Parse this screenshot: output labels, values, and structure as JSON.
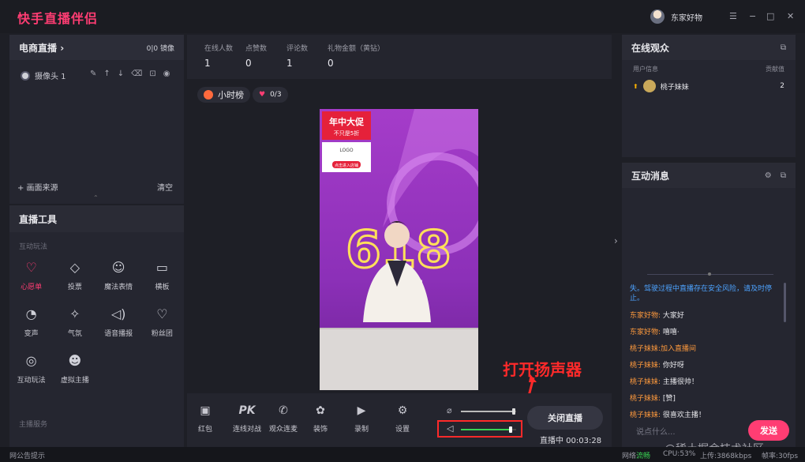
{
  "app": {
    "title": "快手直播伴侣",
    "user": "东家好物"
  },
  "window_controls": {
    "menu": "☰",
    "min": "−",
    "max": "□",
    "close": "✕"
  },
  "left_top": {
    "title": "电商直播",
    "title_suffix": "›",
    "camera_switch": "0|0 镜像",
    "camera_label": "摄像头 1",
    "add_source": "+ 画面来源",
    "clear": "清空"
  },
  "tools": {
    "title": "直播工具",
    "section_interact": "互动玩法",
    "section_anchor": "主播服务",
    "items": [
      {
        "label": "心愿单",
        "icon": "♡",
        "active": true
      },
      {
        "label": "投票",
        "icon": "◇"
      },
      {
        "label": "魔法表情",
        "icon": "☺"
      },
      {
        "label": "横板",
        "icon": "▭"
      },
      {
        "label": "变声",
        "icon": "◔"
      },
      {
        "label": "气氛",
        "icon": "✧"
      },
      {
        "label": "语音播报",
        "icon": "◁)"
      },
      {
        "label": "粉丝团",
        "icon": "♡"
      },
      {
        "label": "互动玩法",
        "icon": "◎"
      },
      {
        "label": "虚拟主播",
        "icon": "☻"
      }
    ]
  },
  "stats": [
    {
      "label": "在线人数",
      "value": "1"
    },
    {
      "label": "点赞数",
      "value": "0"
    },
    {
      "label": "评论数",
      "value": "1"
    },
    {
      "label": "礼物金额（黄钻）",
      "value": "0"
    }
  ],
  "badges": {
    "hour_rank": "小时榜",
    "wish_count": "0/3"
  },
  "video": {
    "banner1": "年中大促",
    "banner2": "不只是5折",
    "logo_text": "LOGO",
    "shop": "点击进入店铺",
    "big": "618",
    "poster": "大促"
  },
  "bottom_tools": [
    {
      "label": "红包",
      "icon": "▣"
    },
    {
      "label": "连线对战",
      "icon": "PK"
    },
    {
      "label": "观众连麦",
      "icon": "✆"
    },
    {
      "label": "装饰",
      "icon": "✿"
    },
    {
      "label": "录制",
      "icon": "▶"
    },
    {
      "label": "设置",
      "icon": "⚙"
    }
  ],
  "volume": {
    "mic_level": 0.95,
    "speaker_level": 0.9
  },
  "close_live": "关闭直播",
  "live_status": "直播中 00:03:28",
  "annotation": "打开扬声器",
  "audience": {
    "title": "在线观众",
    "col_user": "用户信息",
    "col_score": "贡献值",
    "rows": [
      {
        "name": "桃子妹妹",
        "score": "2"
      }
    ]
  },
  "messages": {
    "title": "互动消息",
    "list": [
      {
        "text": "失。驾驶过程中直播存在安全风险，请及时停止。",
        "type": "system"
      },
      {
        "name": "东家好物:",
        "text": " 大家好",
        "type": "chat"
      },
      {
        "name": "东家好物:",
        "text": " 嘻嘻·",
        "type": "chat"
      },
      {
        "name": "桃子妹妹:",
        "text": "加入直播间",
        "type": "join"
      },
      {
        "name": "桃子妹妹:",
        "text": " 你好呀",
        "type": "chat"
      },
      {
        "name": "桃子妹妹:",
        "text": " 主播很帅！",
        "type": "chat"
      },
      {
        "name": "桃子妹妹:",
        "text": " [赞]",
        "type": "chat"
      },
      {
        "name": "桃子妹妹:",
        "text": " 很喜欢主播！",
        "type": "chat"
      }
    ],
    "placeholder": "说点什么...",
    "send": "发送"
  },
  "status": {
    "notice": "网公告提示",
    "network": "网络:",
    "network_v": "流畅",
    "cpu": "CPU:53%",
    "upload": "上传:3868kbps",
    "frame": "帧率:30fps"
  },
  "watermark": "@稀土掘金技术社区",
  "colors": {
    "accent": "#ff3d73",
    "green": "#39d353",
    "annot": "#ff2a2a"
  }
}
